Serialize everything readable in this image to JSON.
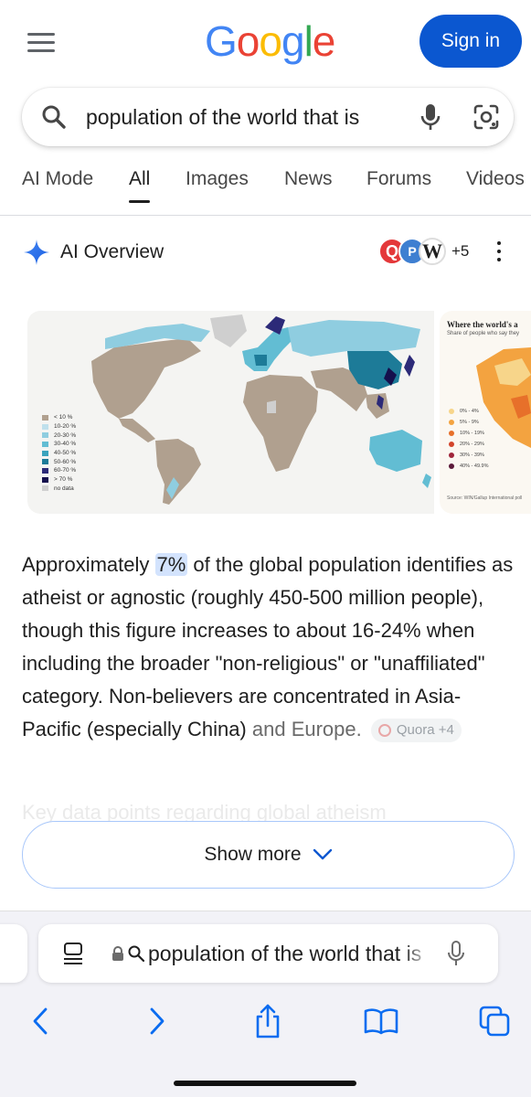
{
  "header": {
    "logo_letters": [
      "G",
      "o",
      "o",
      "g",
      "l",
      "e"
    ],
    "logo_colors": [
      "#4285f4",
      "#ea4335",
      "#fbbc05",
      "#4285f4",
      "#34a853",
      "#ea4335"
    ],
    "signin_label": "Sign in"
  },
  "search": {
    "query": "population of the world that is"
  },
  "tabs": [
    "AI Mode",
    "All",
    "Images",
    "News",
    "Forums",
    "Videos"
  ],
  "active_tab": "All",
  "ai_overview": {
    "title": "AI Overview",
    "source_icons": [
      "Q",
      "P",
      "W"
    ],
    "source_more": "+5",
    "map_legend": [
      "< 10 %",
      "10-20 %",
      "20-30 %",
      "30-40 %",
      "40-50 %",
      "50-60 %",
      "60-70 %",
      "> 70 %",
      "no data"
    ],
    "map_legend_colors": [
      "#b0a08f",
      "#bfe0ec",
      "#8fcde0",
      "#62bdd3",
      "#3aa3bd",
      "#1d7b98",
      "#2c2a78",
      "#15104d",
      "#cfcfcf"
    ],
    "side_image": {
      "title": "Where the world's a",
      "subtitle": "Share of people who say they",
      "legend": [
        "0% - 4%",
        "5% - 9%",
        "10% - 19%",
        "20% - 29%",
        "30% - 39%",
        "40% - 49.9%"
      ],
      "legend_colors": [
        "#f7d58a",
        "#f3a340",
        "#e7702a",
        "#d2452b",
        "#a0253a",
        "#5c1a3a"
      ],
      "source": "Source: WIN/Gallup International poll"
    },
    "answer": {
      "part1": "Approximately ",
      "highlight": "7%",
      "part2": " of the global population identifies as atheist or agnostic (roughly 450-500 million people), though this figure increases to about 16-24% when including the broader \"non-religious\" or \"unaffiliated\" category. Non-believers are concentrated in Asia-Pacific (especially China) ",
      "tail": "and Europe.",
      "citation": "Quora +4"
    },
    "ghost_line": "Key data points regarding global atheism",
    "show_more": "Show more"
  },
  "browser": {
    "url_text": "population of the world that is"
  }
}
